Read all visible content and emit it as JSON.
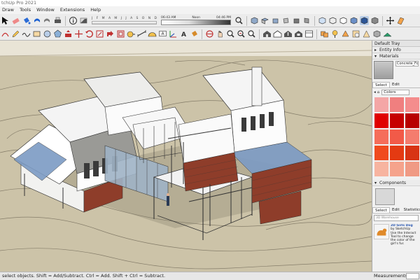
{
  "app": {
    "title": "tchUp Pro 2021"
  },
  "menu": [
    "Draw",
    "Tools",
    "Window",
    "Extensions",
    "Help"
  ],
  "shadow": {
    "months": [
      "J",
      "F",
      "M",
      "A",
      "M",
      "J",
      "J",
      "A",
      "S",
      "O",
      "N",
      "D"
    ],
    "time_start": "06:43 AM",
    "time_noon": "Noon",
    "time_end": "04:46 PM"
  },
  "tray": {
    "title": "Default Tray",
    "entity_info": "Entity Info",
    "materials": "Materials",
    "material_name": "Concrete_Form",
    "tab_select": "Select",
    "tab_edit": "Edit",
    "colors_label": "Colors",
    "swatches": [
      "#f4a6a6",
      "#f07f7f",
      "#f48d8d",
      "#e00000",
      "#c60000",
      "#b80000",
      "#f56d5a",
      "#f25a48",
      "#f47c6e",
      "#f04a1e",
      "#e43a12",
      "#d83414",
      "#f7b4a0",
      "#f5a38c",
      "#f09a84"
    ],
    "components": "Components",
    "comp_tab_select": "Select",
    "comp_tab_edit": "Edit",
    "comp_tab_stats": "Statistics",
    "search_placeholder": "3D Warehouse",
    "dog_title": "2D Girls Dog",
    "dog_author": "by SketchUp",
    "dog_desc": "Use the Interact Tool to change the color of the girl's fur."
  },
  "status": {
    "message": "select objects. Shift = Add/Subtract. Ctrl = Add. Shift + Ctrl = Subtract.",
    "measurements": "Measurements"
  },
  "colors": {
    "ground": "#ccc3a8",
    "sky": "#e9e4d6",
    "accent": "#1a73e8"
  }
}
